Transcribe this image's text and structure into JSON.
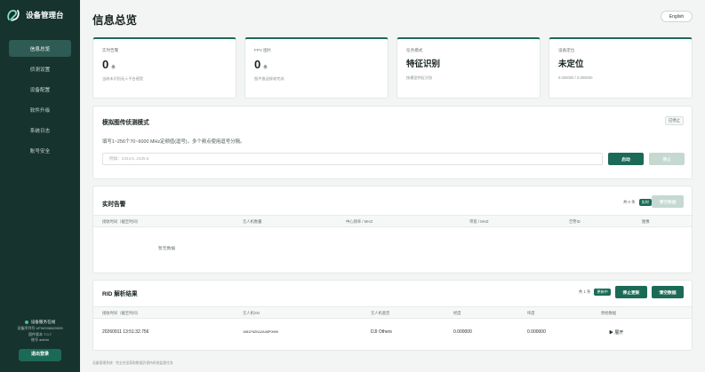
{
  "app": {
    "title": "设备管理台",
    "logo_icon": "brand-logo-icon"
  },
  "sidebar": {
    "items": [
      {
        "label": "信息总览",
        "active": true
      },
      {
        "label": "侦测设置",
        "active": false
      },
      {
        "label": "设备配置",
        "active": false
      },
      {
        "label": "软件升级",
        "active": false
      },
      {
        "label": "系统日志",
        "active": false
      },
      {
        "label": "账号安全",
        "active": false
      }
    ],
    "footer": {
      "service_status": "设备服务在线",
      "device_id": "设备序列号 UFWG06620005",
      "version": "固件版本 7.0.7",
      "user": "账号 admin",
      "logout_label": "退出登录"
    }
  },
  "header": {
    "title": "信息总览",
    "lang_button": "English"
  },
  "stats": [
    {
      "label": "实时告警",
      "value": "0",
      "unit": "条",
      "sub": "当前未识别无人平台感受"
    },
    {
      "label": "FPV 图片",
      "value": "0",
      "unit": "条",
      "sub": "图片推送接收完成"
    },
    {
      "label": "任务模式",
      "value": "特征识别",
      "unit": "",
      "sub": "按模型特征识别"
    },
    {
      "label": "设备定位",
      "value": "未定位",
      "unit": "",
      "sub": "0.000000 / 0.000000"
    }
  ],
  "sim": {
    "title": "模拟图传侦测模式",
    "status": "已停止",
    "hint": "填写1~256个70~6000 MHz定频值(逗号)，多个频点使用逗号分隔。",
    "input_placeholder": "例如：2424.5, 2425.5",
    "start_label": "启动",
    "stop_label": "停止"
  },
  "alerts": {
    "title": "实时告警",
    "count_text": "共 0 条",
    "live_badge": "实时",
    "clear_label": "清空数据",
    "columns": [
      "接收时间（截至时间）",
      "无人机数量",
      "中心频率 / MHZ",
      "带宽 / MHZ",
      "告警ID",
      "图像"
    ],
    "empty_text": "暂无数据"
  },
  "rid": {
    "title": "RID 解析结果",
    "count_text": "共 1 条",
    "updating_badge": "更新中",
    "stop_update_label": "停止更新",
    "clear_label": "清空数据",
    "columns": [
      "接收时间（截至时间）",
      "无人机SN",
      "无人机类型",
      "经度",
      "纬度",
      "原始数据"
    ],
    "rows": [
      {
        "time": "20260911 13:51:32.756",
        "sn": "1581F6ZN12A06P0999",
        "type": "DJI Others",
        "lon": "0.000000",
        "lat": "0.000000",
        "raw": "▶ 展开"
      }
    ]
  },
  "footer_note": "设备管理系统 · 完全合适获取数据仍保持系统监督任务"
}
